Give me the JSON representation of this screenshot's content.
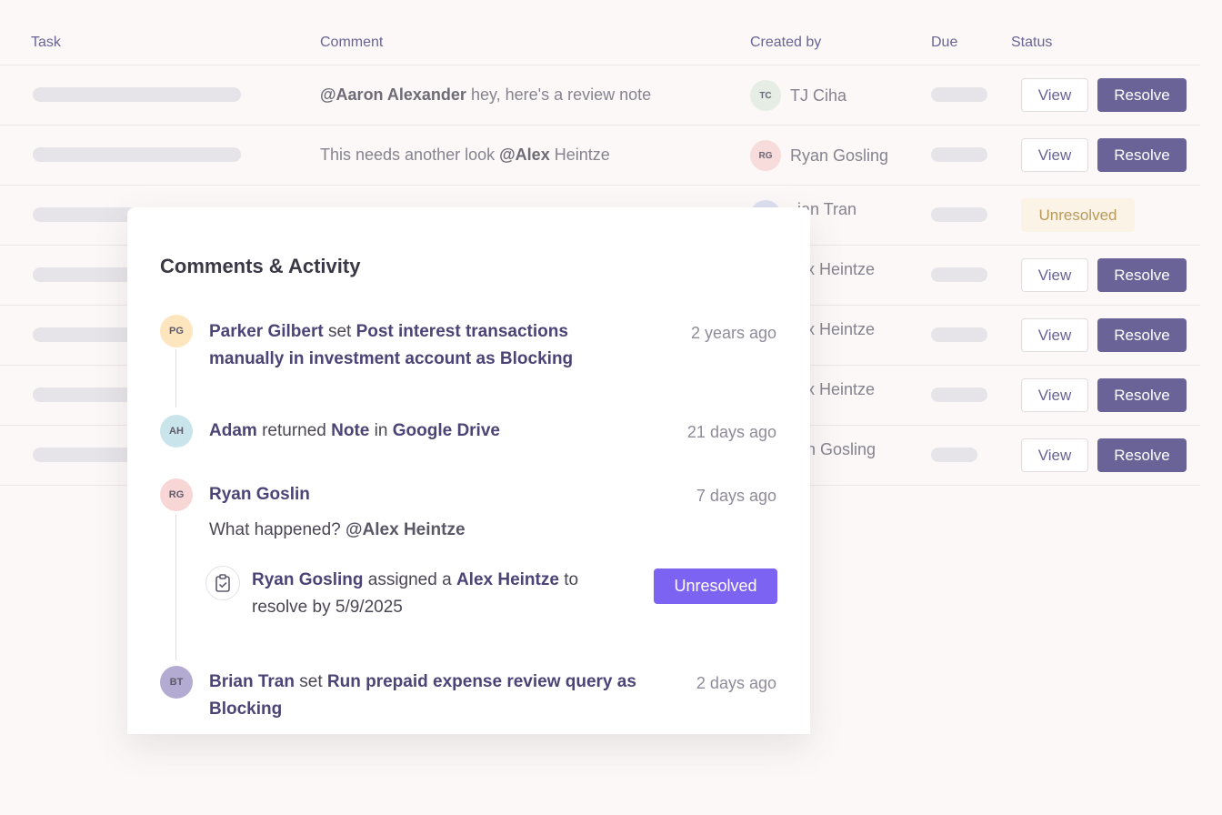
{
  "table": {
    "headers": {
      "task": "Task",
      "comment": "Comment",
      "created_by": "Created by",
      "due": "Due",
      "status": "Status"
    },
    "rows": [
      {
        "comment_mention": "@Aaron Alexander",
        "comment_text": " hey, here's a review note",
        "creator_initials": "TC",
        "creator_name": "TJ Ciha",
        "creator_color": "#e6ede5",
        "status": "actions"
      },
      {
        "comment_text_pre": "This needs another look ",
        "comment_mention": "@Alex",
        "comment_text_post": " Heintze",
        "creator_initials": "RG",
        "creator_name": "Ryan Gosling",
        "creator_color": "#f8dcdb",
        "status": "actions"
      },
      {
        "creator_name": "Brian Tran",
        "creator_name_visible": "ian Tran",
        "status": "unresolved"
      },
      {
        "creator_name_visible": "ex Heintze",
        "status": "actions"
      },
      {
        "creator_name_visible": "ex Heintze",
        "status": "actions"
      },
      {
        "creator_name_visible": "ex Heintze",
        "status": "actions"
      },
      {
        "creator_name_visible": "an Gosling",
        "status": "actions"
      }
    ],
    "view_label": "View",
    "resolve_label": "Resolve",
    "unresolved_label": "Unresolved"
  },
  "modal": {
    "title": "Comments & Activity",
    "activities": [
      {
        "initials": "PG",
        "avatar_color": "#fde6bd",
        "actor": "Parker Gilbert",
        "verb": " set ",
        "object": "Post interest transactions manually in investment account as Blocking",
        "time": "2 years ago"
      },
      {
        "initials": "AH",
        "avatar_color": "#c9e4ea",
        "actor": "Adam",
        "verb": " returned ",
        "object": "Note",
        "prep": " in ",
        "target": "Google Drive",
        "time": "21 days ago"
      },
      {
        "initials": "RG",
        "avatar_color": "#f8d6d6",
        "actor": "Ryan Goslin",
        "time": "7 days ago",
        "message": "What happened? ",
        "message_mention": "@Alex Heintze",
        "sub": {
          "icon": "clipboard-check-icon",
          "actor": "Ryan Gosling",
          "verb": " assigned a ",
          "assignee": "Alex Heintze",
          "rest": " to resolve by 5/9/2025",
          "status_label": "Unresolved"
        }
      },
      {
        "initials": "BT",
        "avatar_color": "#b3abd1",
        "actor": "Brian Tran",
        "verb": " set ",
        "object": "Run prepaid expense review query as Blocking",
        "time": "2 days ago"
      }
    ]
  },
  "colors": {
    "accent": "#696398",
    "accent_bright": "#7c63f2",
    "warning_bg": "#fbf3e6",
    "warning_text": "#b89a5c"
  }
}
